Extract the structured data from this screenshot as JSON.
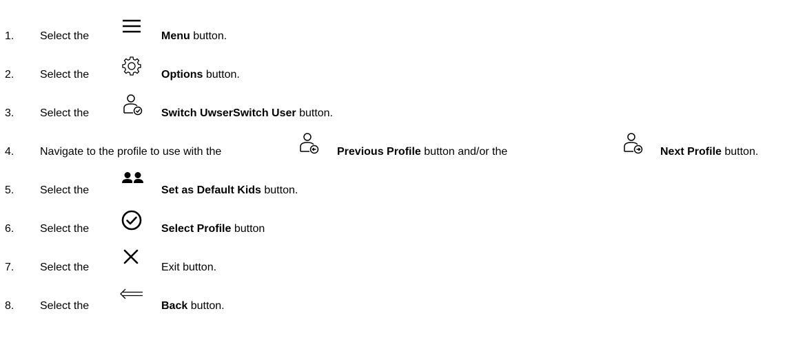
{
  "steps": [
    {
      "number": "1.",
      "prefix": "Select the",
      "icon": "menu-icon",
      "bold": "Menu",
      "suffix": " button."
    },
    {
      "number": "2.",
      "prefix": "Select the",
      "icon": "gear-icon",
      "bold": "Options",
      "suffix": " button."
    },
    {
      "number": "3.",
      "prefix": "Select the",
      "icon": "switch-user-icon",
      "bold": "Switch UwserSwitch User",
      "suffix": " button."
    },
    {
      "number": "4.",
      "prefix": "Navigate to the profile to use with the",
      "icon": "previous-profile-icon",
      "bold": "Previous Profile",
      "middle": " button and/or the",
      "icon2": "next-profile-icon",
      "bold2": "Next Profile",
      "suffix": " button."
    },
    {
      "number": "5.",
      "prefix": "Select the",
      "icon": "kids-icon",
      "bold": "Set as Default Kids",
      "suffix": " button."
    },
    {
      "number": "6.",
      "prefix": "Select the",
      "icon": "check-circle-icon",
      "bold": "Select Profile",
      "suffix": " button"
    },
    {
      "number": "7.",
      "prefix": "Select the",
      "icon": "close-icon",
      "plain": "Exit",
      "suffix": " button."
    },
    {
      "number": "8.",
      "prefix": "Select the",
      "icon": "back-arrow-icon",
      "bold": "Back",
      "suffix": " button."
    }
  ]
}
